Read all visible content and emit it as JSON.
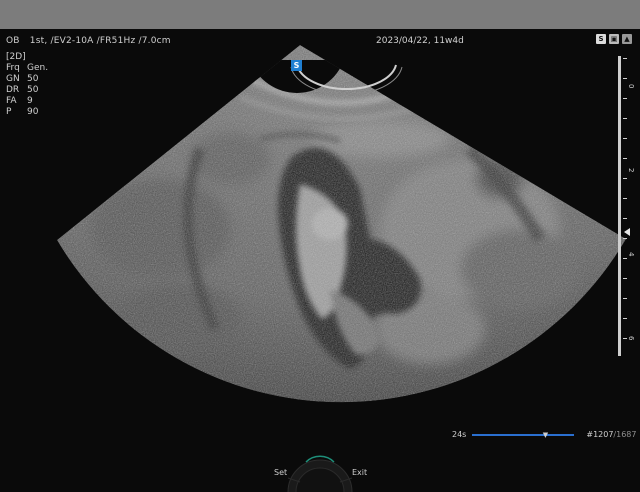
{
  "header": {
    "preset": "OB",
    "patient_tab": "1st,",
    "probe": "EV2-10A",
    "frame_rate": "FR51Hz",
    "depth": "7.0cm",
    "datetime": "2023/04/22, 11w4d"
  },
  "mode_panel": {
    "mode": "[2D]",
    "params": [
      {
        "key": "Frq",
        "value": "Gen."
      },
      {
        "key": "GN",
        "value": "50"
      },
      {
        "key": "DR",
        "value": "50"
      },
      {
        "key": "FA",
        "value": "9"
      },
      {
        "key": "P",
        "value": "90"
      }
    ]
  },
  "orientation_marker": "S",
  "status_icons": [
    "S",
    "SD",
    "DL"
  ],
  "scale_ticks": [
    "0",
    "2",
    "4",
    "6"
  ],
  "cine": {
    "duration": "24s",
    "frame_current": "#1207",
    "frame_total": "/1687",
    "progress": 0.716
  },
  "controls": {
    "set_label": "Set",
    "exit_label": "Exit"
  }
}
